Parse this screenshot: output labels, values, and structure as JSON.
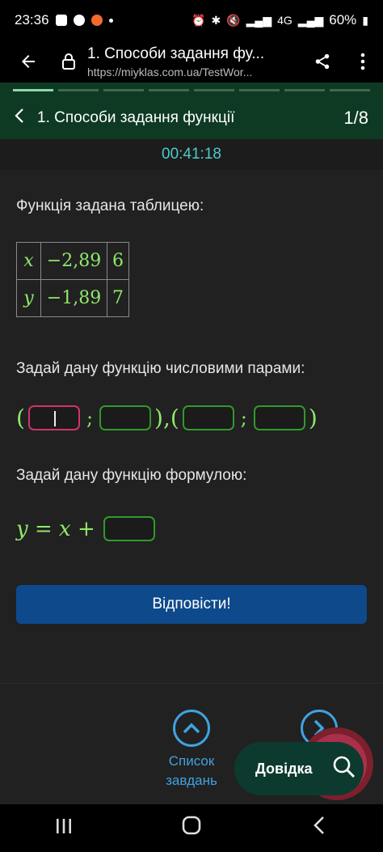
{
  "status_bar": {
    "time": "23:36",
    "network": "4G",
    "battery": "60%"
  },
  "browser": {
    "title": "1. Способи задання фу...",
    "url": "https://miyklas.com.ua/TestWor..."
  },
  "task": {
    "title": "1. Способи задання функції",
    "counter": "1/8",
    "timer": "00:41:18"
  },
  "question": {
    "prompt_table": "Функція задана таблицею:",
    "table": {
      "rows": [
        {
          "var": "x",
          "v1": "−2,89",
          "v2": "6"
        },
        {
          "var": "y",
          "v1": "−1,89",
          "v2": "7"
        }
      ]
    },
    "prompt_pairs": "Задай дану функцію числовими парами:",
    "pairs": {
      "open1": "(",
      "sep1": ";",
      "close_comma": "),",
      "open2": "(",
      "sep2": ";",
      "close2": ")"
    },
    "prompt_formula": "Задай дану функцію формулою:",
    "formula": {
      "y": "y",
      "eq": " = ",
      "x": "x",
      "plus": " +"
    },
    "answer_button": "Відповісти!"
  },
  "bottom": {
    "list_label": "Список завдань",
    "help_label": "Довідка"
  },
  "colors": {
    "header_green": "#0e3a24",
    "math_green": "#8fe86b",
    "timer_cyan": "#4ec9c9",
    "button_blue": "#0e4a8b",
    "link_blue": "#3fa3e0",
    "focus_pink": "#d1336e"
  }
}
